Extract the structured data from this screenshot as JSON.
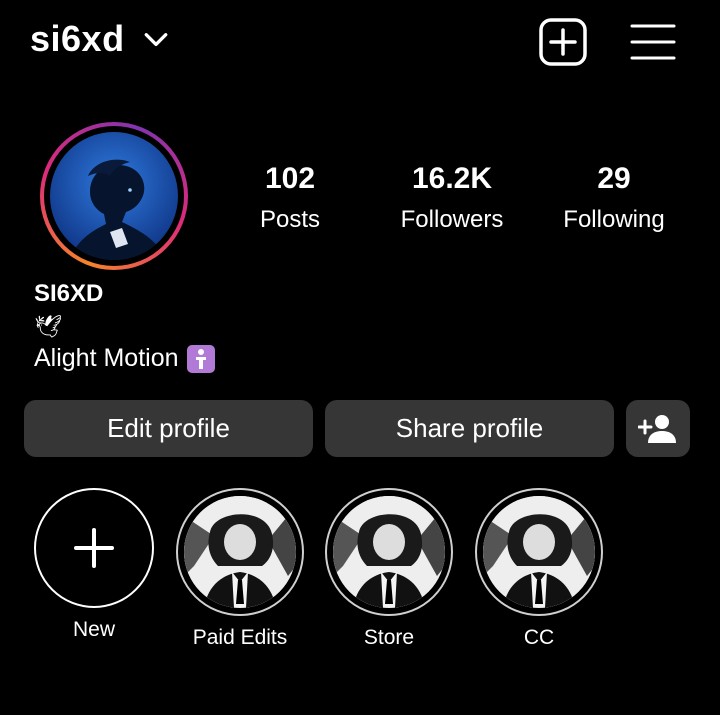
{
  "header": {
    "username": "si6xd"
  },
  "stats": {
    "posts": {
      "count": "102",
      "label": "Posts"
    },
    "followers": {
      "count": "16.2K",
      "label": "Followers"
    },
    "following": {
      "count": "29",
      "label": "Following"
    }
  },
  "bio": {
    "display_name": "SI6XD",
    "emoji": "🕊",
    "text": "Alight Motion"
  },
  "actions": {
    "edit_label": "Edit profile",
    "share_label": "Share profile"
  },
  "highlights": [
    {
      "label": "New"
    },
    {
      "label": "Paid Edits"
    },
    {
      "label": "Store"
    },
    {
      "label": "CC"
    }
  ]
}
